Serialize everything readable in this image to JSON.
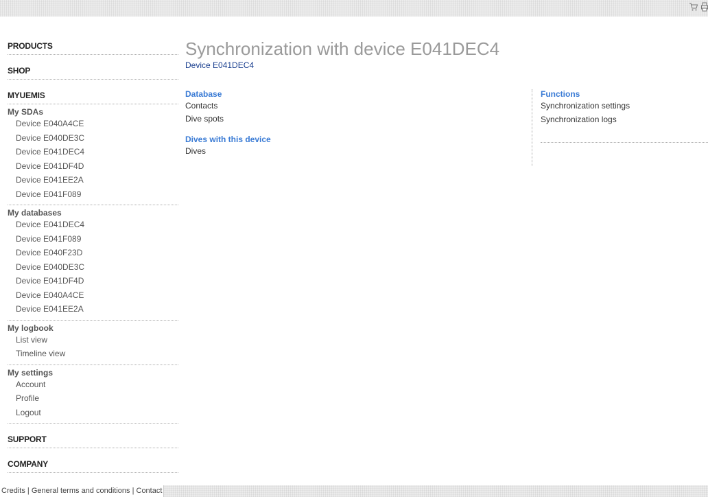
{
  "sidebar": {
    "products": "PRODUCTS",
    "shop": "SHOP",
    "myuemis": "MYUEMIS",
    "groups": [
      {
        "title": "My SDAs",
        "items": [
          "Device E040A4CE",
          "Device E040DE3C",
          "Device E041DEC4",
          "Device E041DF4D",
          "Device E041EE2A",
          "Device E041F089"
        ]
      },
      {
        "title": "My databases",
        "items": [
          "Device E041DEC4",
          "Device E041F089",
          "Device E040F23D",
          "Device E040DE3C",
          "Device E041DF4D",
          "Device E040A4CE",
          "Device E041EE2A"
        ]
      },
      {
        "title": "My logbook",
        "items": [
          "List view",
          "Timeline view"
        ]
      },
      {
        "title": "My settings",
        "items": [
          "Account",
          "Profile",
          "Logout"
        ]
      }
    ],
    "support": "SUPPORT",
    "company": "COMPANY"
  },
  "main": {
    "title": "Synchronization with device E041DEC4",
    "device_link": "Device E041DEC4",
    "database": {
      "heading": "Database",
      "links": [
        "Contacts",
        "Dive spots"
      ]
    },
    "dives": {
      "heading": "Dives with this device",
      "links": [
        "Dives"
      ]
    },
    "functions": {
      "heading": "Functions",
      "links": [
        "Synchronization settings",
        "Synchronization logs"
      ]
    }
  },
  "footer": {
    "credits": "Credits",
    "sep": " | ",
    "terms": "General terms and conditions",
    "contact": "Contact"
  },
  "icons": {
    "cart": "cart-icon",
    "print": "print-icon"
  },
  "colors": {
    "heading_blue": "#3a7bd5",
    "title_gray": "#9a9a9a",
    "device_link": "#1a3f8f"
  }
}
